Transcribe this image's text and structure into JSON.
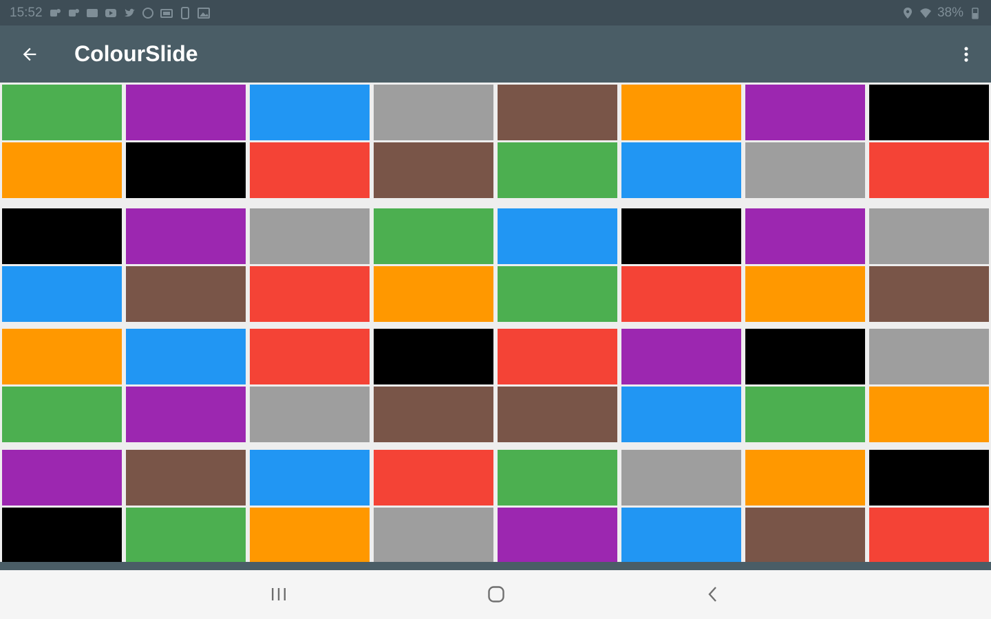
{
  "status_bar": {
    "time": "15:52",
    "battery": "38%",
    "left_icons": [
      "teams-icon",
      "teams-icon",
      "mail-icon",
      "youtube-icon",
      "twitter-icon",
      "clock-icon",
      "screen-icon",
      "phone-icon",
      "image-icon"
    ]
  },
  "app_bar": {
    "title": "ColourSlide",
    "back_icon": "arrow-back-icon",
    "menu_icon": "more-vert-icon"
  },
  "colors": {
    "green": "#4caf50",
    "purple": "#9c27b0",
    "blue": "#2196f3",
    "grey": "#9e9e9e",
    "brown": "#795548",
    "orange": "#ff9800",
    "black": "#000000",
    "red": "#f44336"
  },
  "board": {
    "blocks": [
      [
        [
          "green",
          "purple",
          "blue",
          "grey"
        ],
        [
          "orange",
          "black",
          "red",
          "brown"
        ]
      ],
      [
        [
          "brown",
          "orange",
          "purple",
          "black"
        ],
        [
          "green",
          "blue",
          "grey",
          "red"
        ]
      ],
      [
        [
          "black",
          "purple",
          "grey",
          "green"
        ],
        [
          "blue",
          "brown",
          "red",
          "orange"
        ]
      ],
      [
        [
          "blue",
          "black",
          "purple",
          "grey"
        ],
        [
          "green",
          "red",
          "orange",
          "brown"
        ]
      ],
      [
        [
          "orange",
          "blue",
          "red",
          "black"
        ],
        [
          "green",
          "purple",
          "grey",
          "brown"
        ]
      ],
      [
        [
          "red",
          "purple",
          "black",
          "grey"
        ],
        [
          "brown",
          "blue",
          "green",
          "orange"
        ]
      ],
      [
        [
          "purple",
          "brown",
          "blue",
          "red"
        ],
        [
          "black",
          "green",
          "orange",
          "grey"
        ]
      ],
      [
        [
          "green",
          "grey",
          "orange",
          "black"
        ],
        [
          "purple",
          "blue",
          "brown",
          "red"
        ]
      ]
    ]
  },
  "nav_bar": {
    "recents_icon": "recents-icon",
    "home_icon": "home-icon",
    "back_icon": "nav-back-icon"
  }
}
